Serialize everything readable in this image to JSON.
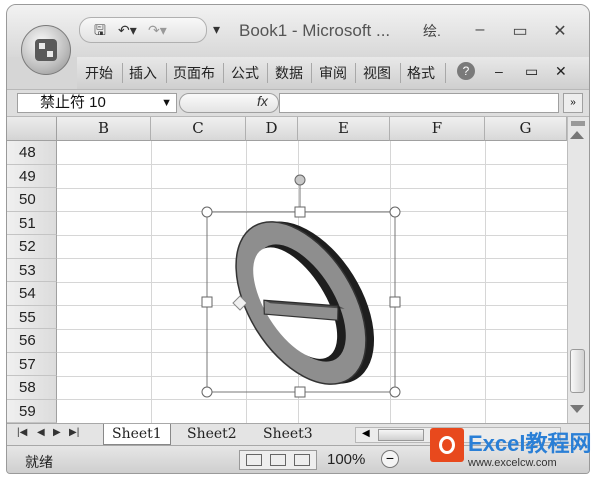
{
  "window": {
    "title": "Book1 - Microsoft ...",
    "context_tab": "绘.",
    "minimize_label": "–",
    "maximize_label": "▭",
    "close_label": "✕"
  },
  "qat": {
    "save_icon": "save-icon",
    "undo_icon": "undo-icon",
    "redo_icon": "redo-icon",
    "customize_icon": "customize-arrow-icon"
  },
  "ribbon": {
    "tabs": [
      "开始",
      "插入",
      "页面布",
      "公式",
      "数据",
      "审阅",
      "视图",
      "格式"
    ],
    "help_label": "?",
    "min_label": "–",
    "restore_label": "▭",
    "close_label": "✕"
  },
  "formula_bar": {
    "name_box": "禁止符 10",
    "fx_label": "fx",
    "formula": ""
  },
  "columns": [
    "B",
    "C",
    "D",
    "E",
    "F",
    "G"
  ],
  "rows": [
    "48",
    "49",
    "50",
    "51",
    "52",
    "53",
    "54",
    "55",
    "56",
    "57",
    "58",
    "59"
  ],
  "sheets": [
    "Sheet1",
    "Sheet2",
    "Sheet3"
  ],
  "active_sheet": "Sheet1",
  "status": {
    "ready": "就绪",
    "zoom": "100%",
    "zoom_minus": "−"
  },
  "shape": {
    "name": "no-symbol-shape",
    "fill": "#8e8e8e",
    "side": "#1e1e1e"
  },
  "watermark": {
    "brand": "Excel教程网",
    "url": "www.excelcw.com"
  }
}
